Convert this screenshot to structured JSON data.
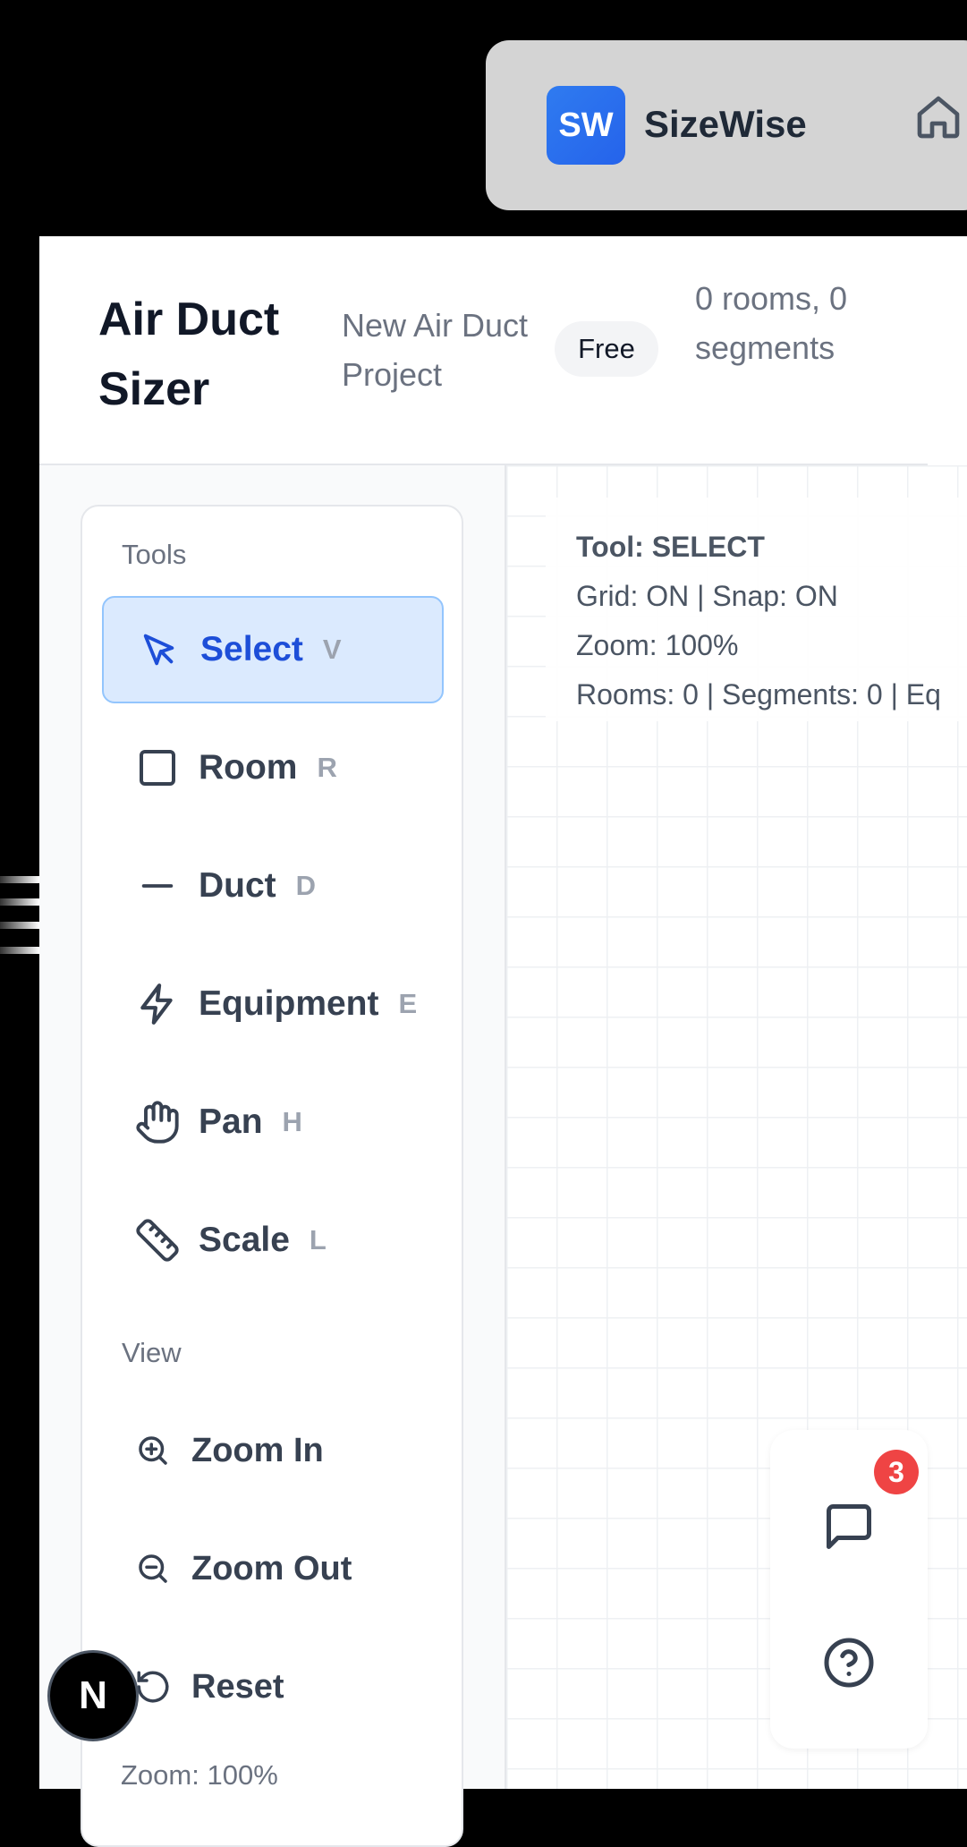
{
  "nav": {
    "logo_text": "SW",
    "brand": "SizeWise",
    "home_icon": "home-icon"
  },
  "header": {
    "title": "Air Duct Sizer",
    "project_name": "New Air Duct Project",
    "plan_badge": "Free",
    "counts": "0 rooms, 0 segments"
  },
  "sidebar": {
    "tools_label": "Tools",
    "tools": [
      {
        "label": "Select",
        "key": "V",
        "icon": "cursor-arrow-icon",
        "active": true
      },
      {
        "label": "Room",
        "key": "R",
        "icon": "square-icon",
        "active": false
      },
      {
        "label": "Duct",
        "key": "D",
        "icon": "minus-line-icon",
        "active": false
      },
      {
        "label": "Equipment",
        "key": "E",
        "icon": "lightning-icon",
        "active": false
      },
      {
        "label": "Pan",
        "key": "H",
        "icon": "hand-icon",
        "active": false
      },
      {
        "label": "Scale",
        "key": "L",
        "icon": "ruler-icon",
        "active": false
      }
    ],
    "view_label": "View",
    "view_items": [
      {
        "label": "Zoom In",
        "icon": "zoom-in-icon"
      },
      {
        "label": "Zoom Out",
        "icon": "zoom-out-icon"
      },
      {
        "label": "Reset",
        "icon": "reset-icon"
      }
    ],
    "zoom_footer": "Zoom: 100%"
  },
  "canvas": {
    "status": {
      "tool": "Tool: SELECT",
      "grid_snap": "Grid: ON | Snap: ON",
      "zoom": "Zoom: 100%",
      "counts": "Rooms: 0 | Segments: 0 | Eq"
    }
  },
  "fab": {
    "notification_count": "3",
    "chat_icon": "chat-icon",
    "help_icon": "help-icon"
  },
  "dev": {
    "next_label": "N"
  },
  "colors": {
    "accent": "#2563eb",
    "active_bg": "#dbeafe",
    "badge": "#ef4444"
  }
}
